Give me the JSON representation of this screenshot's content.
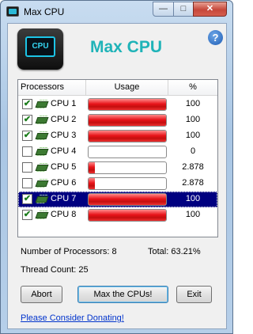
{
  "window": {
    "title": "Max CPU"
  },
  "titlebar_buttons": {
    "minimize": "—",
    "maximize": "□",
    "close": "✕"
  },
  "app": {
    "logo_text": "CPU",
    "heading": "Max CPU",
    "help_glyph": "?"
  },
  "list": {
    "columns": [
      "Processors",
      "Usage",
      "%"
    ],
    "rows": [
      {
        "name": "CPU 1",
        "checked": true,
        "usage": 1.0,
        "percent": "100",
        "selected": false
      },
      {
        "name": "CPU 2",
        "checked": true,
        "usage": 1.0,
        "percent": "100",
        "selected": false
      },
      {
        "name": "CPU 3",
        "checked": true,
        "usage": 1.0,
        "percent": "100",
        "selected": false
      },
      {
        "name": "CPU 4",
        "checked": false,
        "usage": 0.0,
        "percent": "0",
        "selected": false
      },
      {
        "name": "CPU 5",
        "checked": false,
        "usage": 0.02878,
        "percent": "2.878",
        "selected": false
      },
      {
        "name": "CPU 6",
        "checked": false,
        "usage": 0.02878,
        "percent": "2.878",
        "selected": false
      },
      {
        "name": "CPU 7",
        "checked": true,
        "usage": 1.0,
        "percent": "100",
        "selected": true
      },
      {
        "name": "CPU 8",
        "checked": true,
        "usage": 1.0,
        "percent": "100",
        "selected": false
      }
    ]
  },
  "stats": {
    "processors": "Number of Processors: 8",
    "total": "Total: 63.21%",
    "threads": "Thread Count: 25"
  },
  "buttons": {
    "abort": "Abort",
    "max": "Max the CPUs!",
    "exit": "Exit"
  },
  "donate_link": "Please Consider Donating!",
  "colors": {
    "bar": "#e8141a",
    "heading": "#1fb3b8",
    "selection": "#000080",
    "link": "#0033cc"
  }
}
